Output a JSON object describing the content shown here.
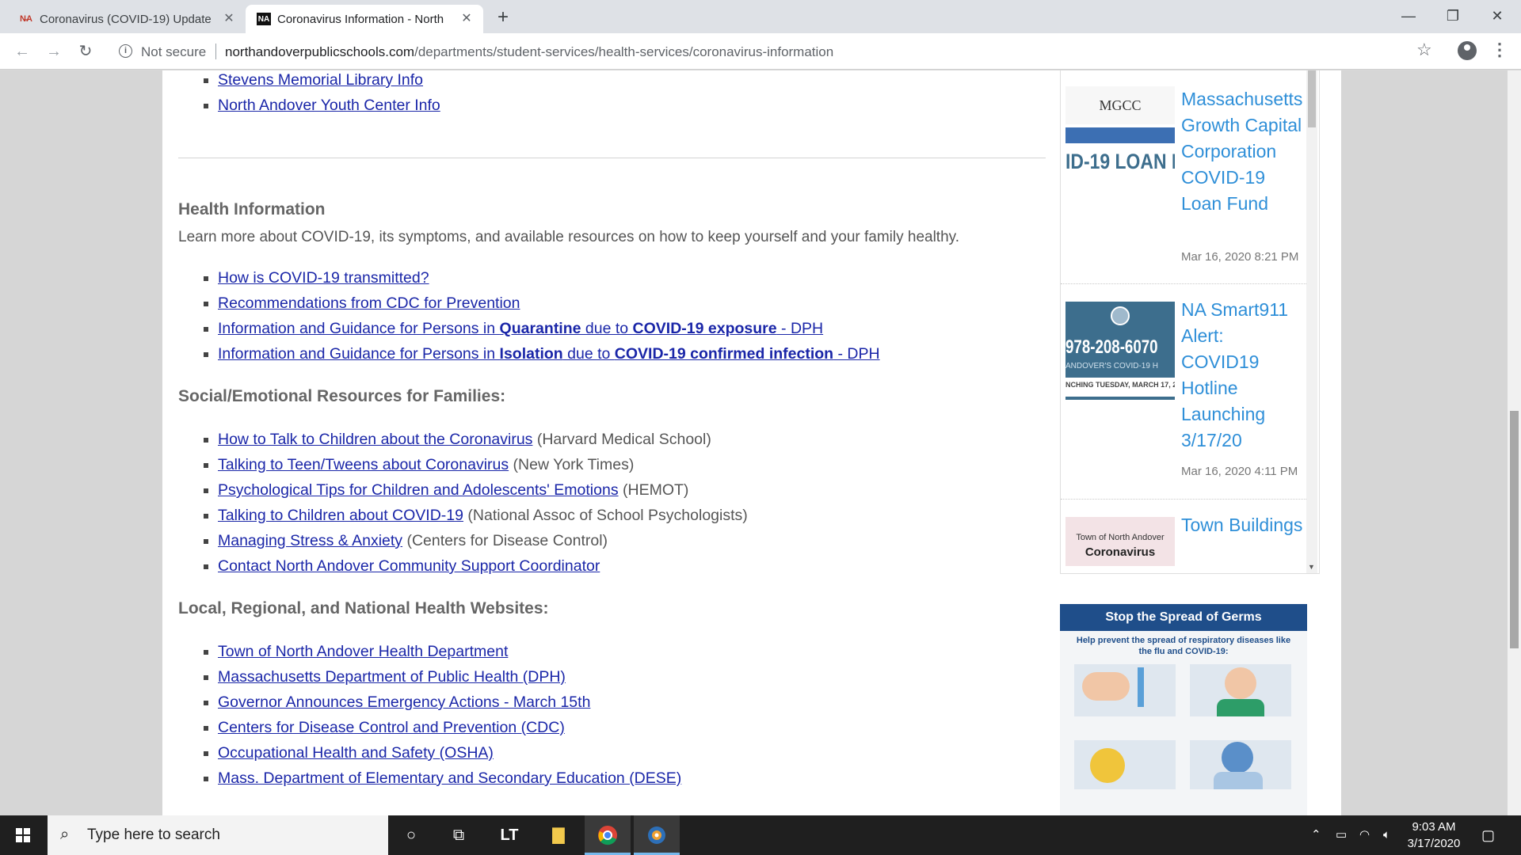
{
  "browser": {
    "tabs": [
      {
        "label": "Coronavirus (COVID-19) Update",
        "favicon": "N̶A"
      },
      {
        "label": "Coronavirus Information - North",
        "favicon": "NA"
      }
    ],
    "new_tab": "+",
    "address": {
      "security_label": "Not secure",
      "domain": "northandoverpublicschools.com",
      "path": "/departments/student-services/health-services/coronavirus-information"
    }
  },
  "content": {
    "top_links": [
      "Stevens Memorial Library Info",
      "North Andover Youth Center Info"
    ],
    "health": {
      "heading": "Health Information",
      "intro": "Learn more about COVID-19, its symptoms, and available resources on how to keep yourself and your family healthy.",
      "links": [
        {
          "text": "How is COVID-19 transmitted?"
        },
        {
          "text": "Recommendations from CDC for Prevention"
        },
        {
          "pre": "Information and Guidance for Persons in ",
          "b1": "Quarantine",
          "mid": " due to ",
          "b2": "COVID-19 exposure",
          "post": " - DPH"
        },
        {
          "pre": "Information and Guidance for Persons in ",
          "b1": "Isolation",
          "mid": " due to ",
          "b2": "COVID-19 confirmed infection",
          "post": " - DPH"
        }
      ]
    },
    "social": {
      "heading": "Social/Emotional Resources for Families:",
      "items": [
        {
          "link": "How to Talk to Children about the Coronavirus",
          "source": " (Harvard Medical School)"
        },
        {
          "link": "Talking to Teen/Tweens about Coronavirus",
          "source": " (New York Times)"
        },
        {
          "link": "Psychological Tips for Children and Adolescents' Emotions",
          "source": " (HEMOT)"
        },
        {
          "link": "Talking to Children about COVID-19",
          "source": " (National Assoc of School Psychologists)"
        },
        {
          "link": "Managing Stress & Anxiety",
          "source": " (Centers for Disease Control)"
        },
        {
          "link": "Contact North Andover Community Support Coordinator ",
          "source": ""
        }
      ]
    },
    "websites": {
      "heading": "Local, Regional, and National Health Websites:",
      "links": [
        "Town of North Andover Health Department ",
        "Massachusetts Department of Public Health (DPH)",
        "Governor Announces Emergency Actions - March 15th",
        "Centers for Disease Control and Prevention (CDC)",
        "Occupational Health and Safety (OSHA)",
        "Mass. Department of Elementary and Secondary Education (DESE)"
      ]
    }
  },
  "sidebar": {
    "news": [
      {
        "title": "Massachusetts Growth Capital Corporation COVID-19 Loan Fund",
        "date": "Mar 16, 2020 8:21 PM",
        "thumb_logo": "MGCC",
        "thumb_text": "ID-19 LOAN F"
      },
      {
        "title": "NA Smart911 Alert: COVID19 Hotline Launching 3/17/20",
        "date": "Mar 16, 2020 4:11 PM",
        "thumb_text": "978-208-6070",
        "thumb_sub": "ANDOVER'S COVID-19 H",
        "thumb_sub2": "NCHING TUESDAY, MARCH 17, 2"
      },
      {
        "title": "Town Buildings",
        "date": "",
        "thumb_text": "Town of North Andover",
        "thumb_sub": "Coronavirus"
      }
    ],
    "poster": {
      "heading": "Stop the Spread of Germs",
      "sub": "Help prevent the spread of respiratory diseases like the flu and COVID-19:"
    }
  },
  "taskbar": {
    "search_placeholder": "Type here to search",
    "time": "9:03 AM",
    "date": "3/17/2020"
  }
}
